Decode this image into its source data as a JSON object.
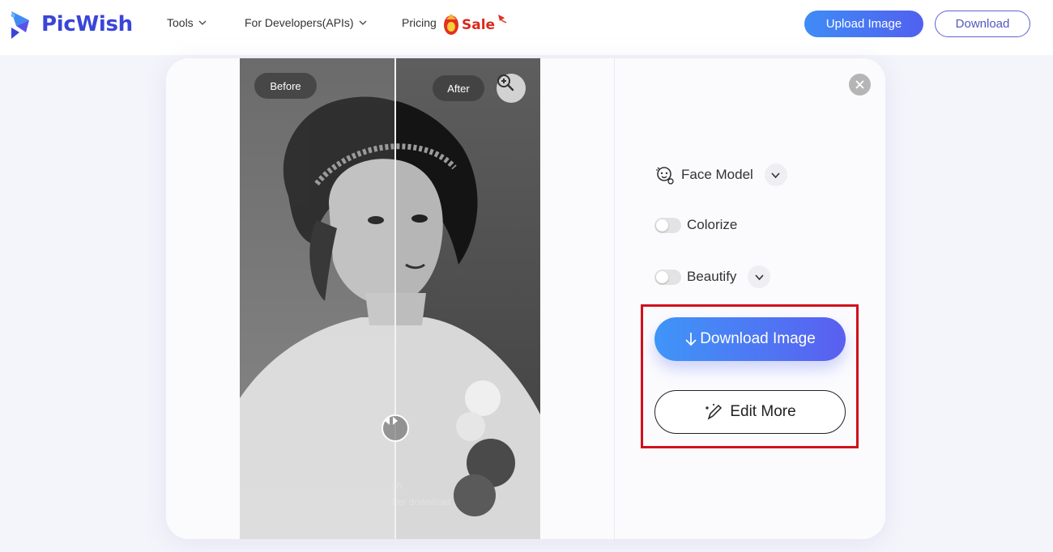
{
  "header": {
    "logo_text": "PicWish",
    "nav": [
      {
        "label": "Tools"
      },
      {
        "label": "For Developers(APIs)"
      },
      {
        "label": "Pricing"
      }
    ],
    "sale_label": "Sale",
    "upload_label": "Upload Image",
    "download_label": "Download"
  },
  "preview": {
    "before_label": "Before",
    "after_label": "After",
    "watermark_line1": "sh",
    "watermark_line2": "fter download"
  },
  "panel": {
    "face_model_label": "Face Model",
    "colorize_label": "Colorize",
    "colorize_on": false,
    "beautify_label": "Beautify",
    "beautify_on": false,
    "download_image_label": "Download Image",
    "edit_more_label": "Edit More"
  },
  "colors": {
    "brand": "#3a45d8",
    "accent_gradient_start": "#3f95f8",
    "accent_gradient_end": "#5a5ff0",
    "highlight": "#d0101c"
  },
  "icons": [
    "logo-icon",
    "chevron-down-icon",
    "sale-gem-icon",
    "zoom-in-icon",
    "split-arrows-icon",
    "close-icon",
    "face-model-icon",
    "arrow-down-icon",
    "magic-pencil-icon"
  ]
}
